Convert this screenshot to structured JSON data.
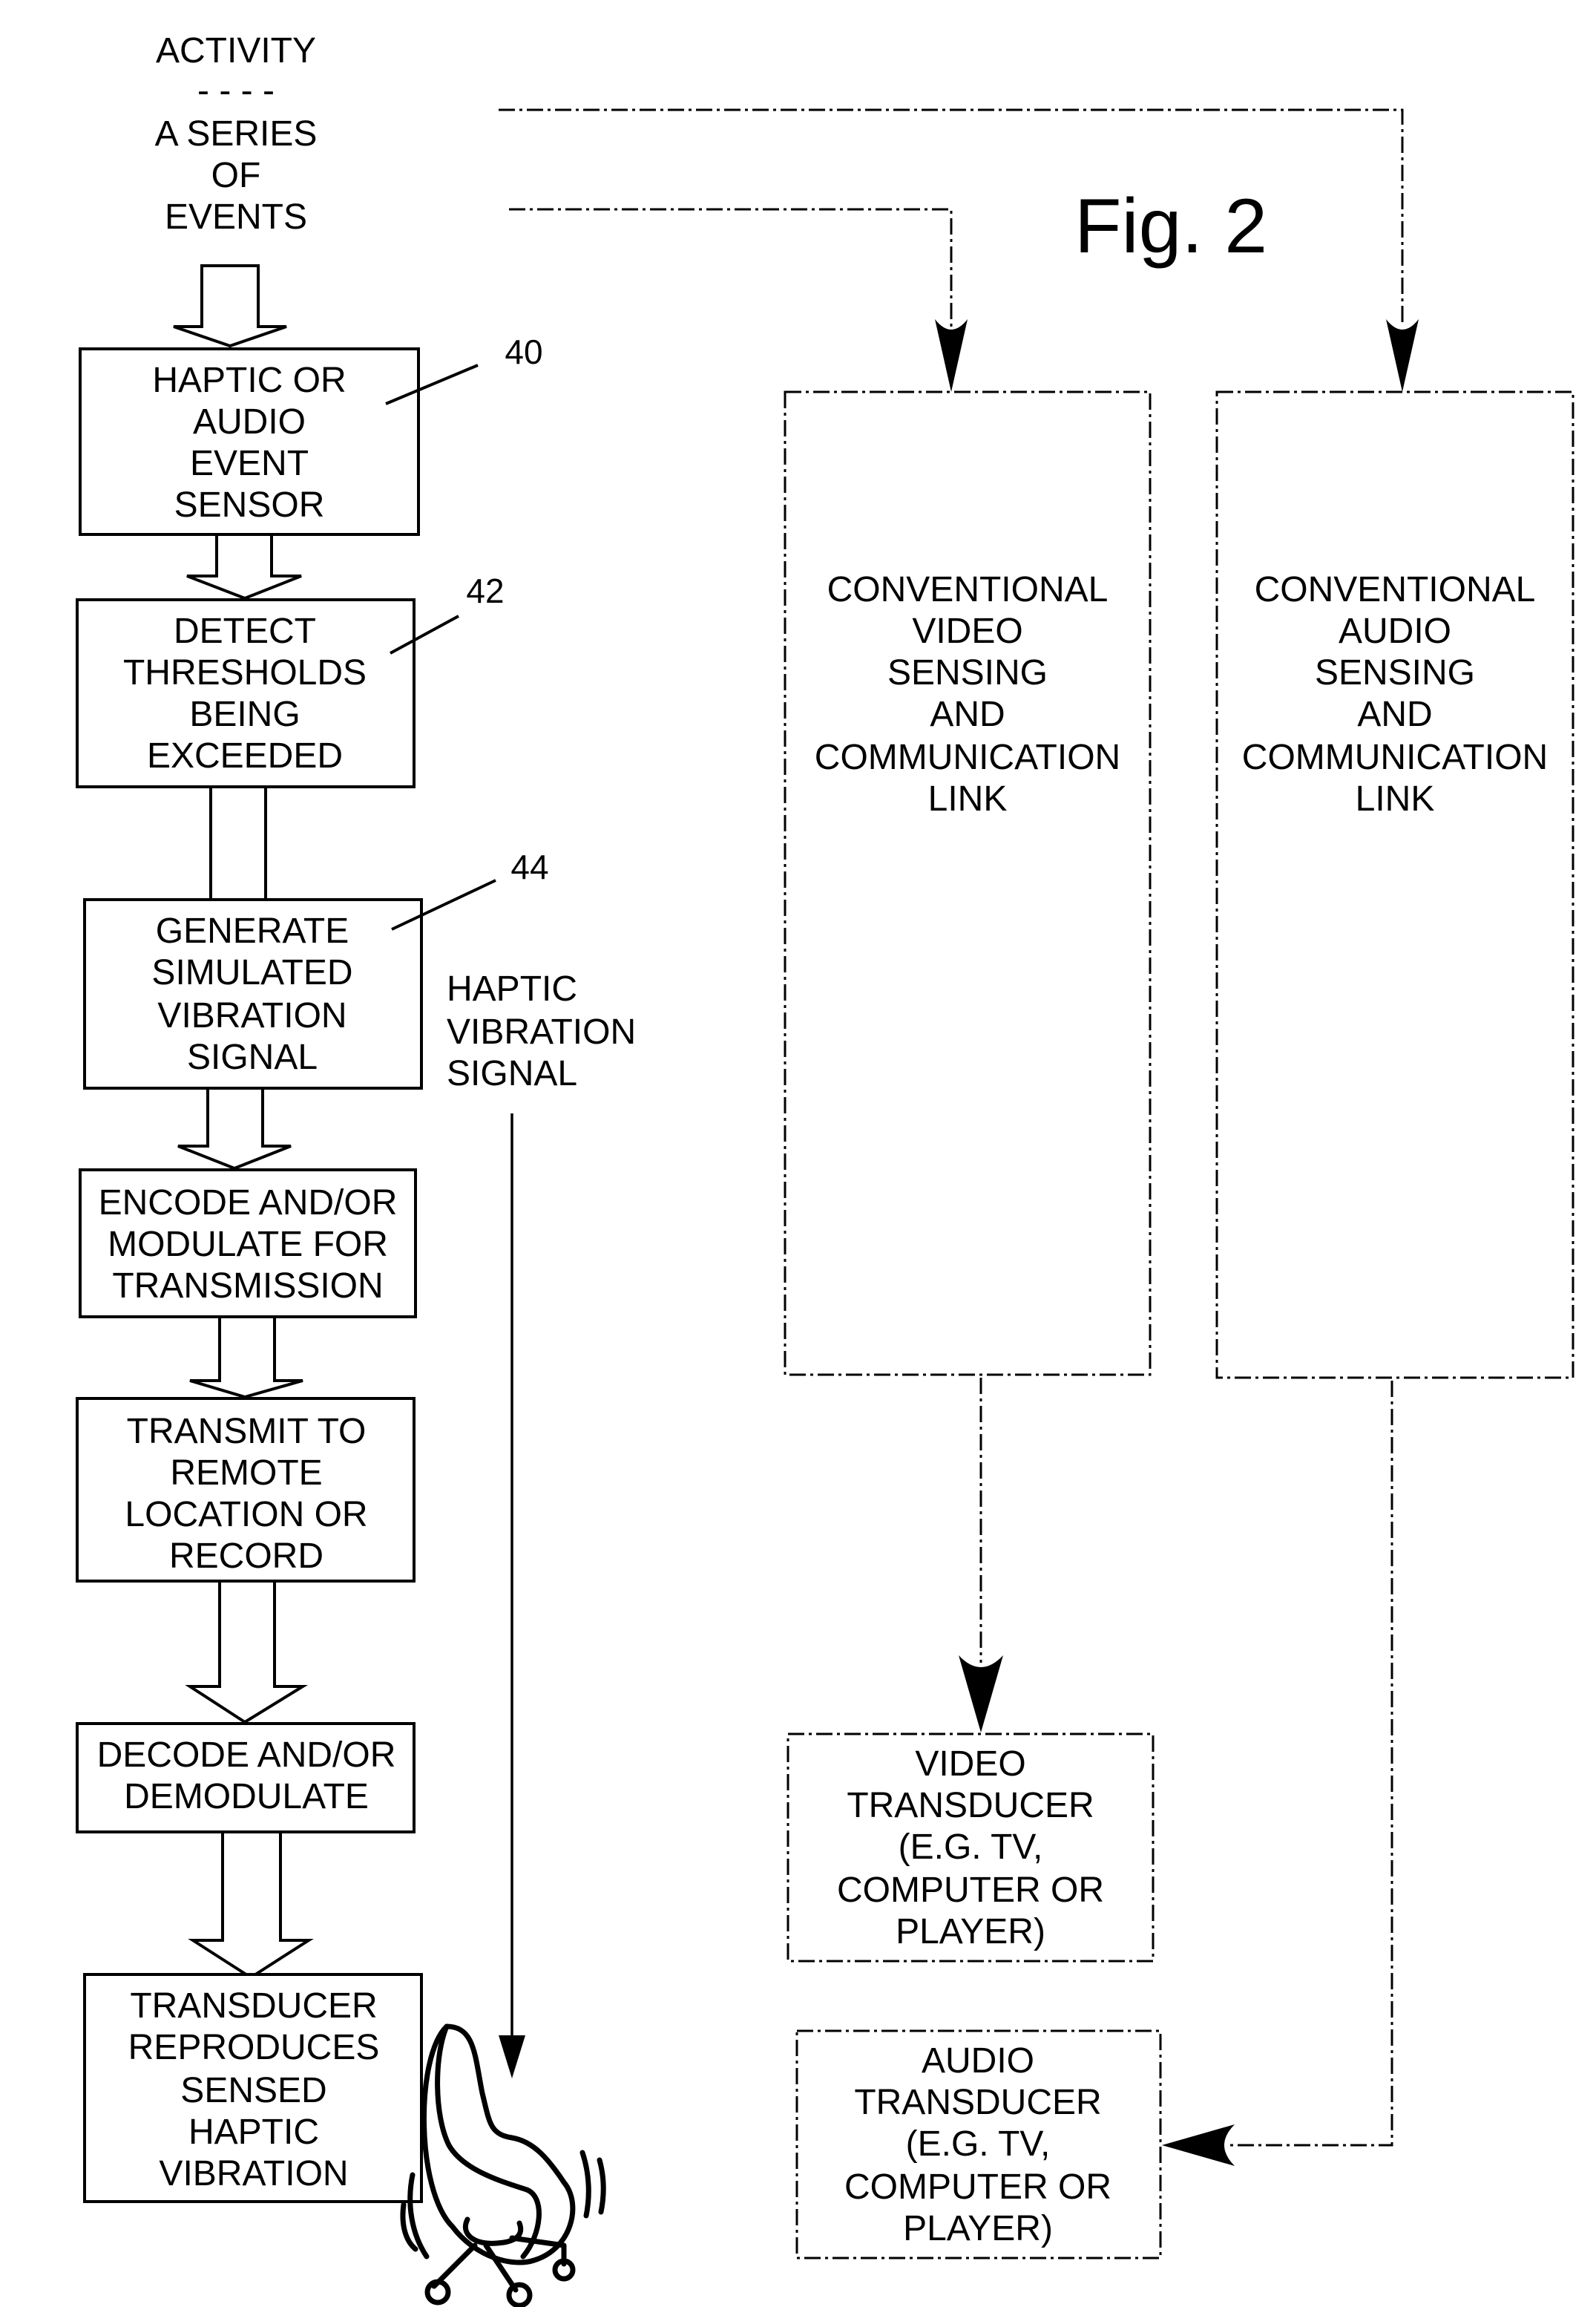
{
  "figure_label": "Fig. 2",
  "source": {
    "lines": [
      "ACTIVITY",
      "- - - -",
      "A SERIES",
      "OF",
      "EVENTS"
    ]
  },
  "flow_blocks": [
    {
      "id": "sensor",
      "ref": "40",
      "lines": [
        "HAPTIC OR",
        "AUDIO",
        "EVENT",
        "SENSOR"
      ]
    },
    {
      "id": "thresholds",
      "ref": "42",
      "lines": [
        "DETECT",
        "THRESHOLDS",
        "BEING",
        "EXCEEDED"
      ]
    },
    {
      "id": "generate",
      "ref": "44",
      "lines": [
        "GENERATE",
        "SIMULATED",
        "VIBRATION",
        "SIGNAL"
      ]
    },
    {
      "id": "encode",
      "ref": "",
      "lines": [
        "ENCODE AND/OR",
        "MODULATE FOR",
        "TRANSMISSION"
      ]
    },
    {
      "id": "transmit",
      "ref": "",
      "lines": [
        "TRANSMIT TO",
        "REMOTE",
        "LOCATION OR",
        "RECORD"
      ]
    },
    {
      "id": "decode",
      "ref": "",
      "lines": [
        "DECODE AND/OR",
        "DEMODULATE"
      ]
    },
    {
      "id": "transducer",
      "ref": "",
      "lines": [
        "TRANSDUCER",
        "REPRODUCES",
        "SENSED",
        "HAPTIC",
        "VIBRATION"
      ]
    }
  ],
  "haptic_signal_label": [
    "HAPTIC",
    "VIBRATION",
    "SIGNAL"
  ],
  "conventional_blocks": [
    {
      "id": "video-link",
      "lines": [
        "CONVENTIONAL",
        "VIDEO",
        "SENSING",
        "AND",
        "COMMUNICATION",
        "LINK"
      ]
    },
    {
      "id": "audio-link",
      "lines": [
        "CONVENTIONAL",
        "AUDIO",
        "SENSING",
        "AND",
        "COMMUNICATION",
        "LINK"
      ]
    }
  ],
  "output_blocks": [
    {
      "id": "video-transducer",
      "lines": [
        "VIDEO",
        "TRANSDUCER",
        "(E.G. TV,",
        "COMPUTER OR",
        "PLAYER)"
      ]
    },
    {
      "id": "audio-transducer",
      "lines": [
        "AUDIO",
        "TRANSDUCER",
        "(E.G. TV,",
        "COMPUTER OR",
        "PLAYER)"
      ]
    }
  ],
  "icons": {
    "chair": "vibrating-chair-icon"
  }
}
